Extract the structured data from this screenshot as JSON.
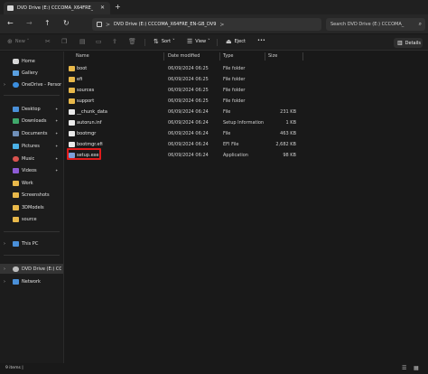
{
  "window": {
    "tab_title": "DVD Drive (E:) CCCOMA_X64FRE_EN-GB_DV9",
    "close_glyph": "✕",
    "new_tab_glyph": "+"
  },
  "addressbar": {
    "back_glyph": "←",
    "forward_glyph": "→",
    "up_glyph": "↑",
    "refresh_glyph": "↻",
    "path_separator": ">",
    "crumb": "DVD Drive (E:) CCCOMA_X64FRE_EN-GB_DV9",
    "search_placeholder": "Search DVD Drive (E:) CCCOMA_"
  },
  "toolbar": {
    "new_label": "New",
    "sort_label": "Sort",
    "view_label": "View",
    "eject_label": "Eject",
    "more_glyph": "•••",
    "details_label": "Details"
  },
  "sidebar": {
    "home": "Home",
    "gallery": "Gallery",
    "onedrive": "OneDrive - Persona",
    "pinned": [
      {
        "label": "Desktop",
        "icon": "desktop-icon"
      },
      {
        "label": "Downloads",
        "icon": "downloads-icon"
      },
      {
        "label": "Documents",
        "icon": "documents-icon"
      },
      {
        "label": "Pictures",
        "icon": "pictures-icon"
      },
      {
        "label": "Music",
        "icon": "music-icon"
      },
      {
        "label": "Videos",
        "icon": "videos-icon"
      }
    ],
    "folders": [
      "Work",
      "Screenshots",
      "3DModels",
      "source"
    ],
    "this_pc": "This PC",
    "dvd_drive": "DVD Drive (E:) CCCOMA",
    "network": "Network"
  },
  "columns": {
    "name": "Name",
    "date": "Date modified",
    "type": "Type",
    "size": "Size"
  },
  "files": [
    {
      "name": "boot",
      "date": "06/09/2024 06:25",
      "type": "File folder",
      "size": "",
      "kind": "folder"
    },
    {
      "name": "efi",
      "date": "06/09/2024 06:25",
      "type": "File folder",
      "size": "",
      "kind": "folder"
    },
    {
      "name": "sources",
      "date": "06/09/2024 06:25",
      "type": "File folder",
      "size": "",
      "kind": "folder"
    },
    {
      "name": "support",
      "date": "06/09/2024 06:25",
      "type": "File folder",
      "size": "",
      "kind": "folder"
    },
    {
      "name": "__chunk_data",
      "date": "06/09/2024 06:24",
      "type": "File",
      "size": "231 KB",
      "kind": "file"
    },
    {
      "name": "autorun.inf",
      "date": "06/09/2024 06:24",
      "type": "Setup Information",
      "size": "1 KB",
      "kind": "file"
    },
    {
      "name": "bootmgr",
      "date": "06/09/2024 06:24",
      "type": "File",
      "size": "463 KB",
      "kind": "file"
    },
    {
      "name": "bootmgr.efi",
      "date": "06/09/2024 06:24",
      "type": "EFI File",
      "size": "2,682 KB",
      "kind": "file"
    },
    {
      "name": "setup.exe",
      "date": "06/09/2024 06:24",
      "type": "Application",
      "size": "98 KB",
      "kind": "app"
    }
  ],
  "status": {
    "items_text": "9 items  |"
  },
  "colors": {
    "highlight": "#e01b1b",
    "folder": "#e8b84a",
    "background": "#191919"
  }
}
